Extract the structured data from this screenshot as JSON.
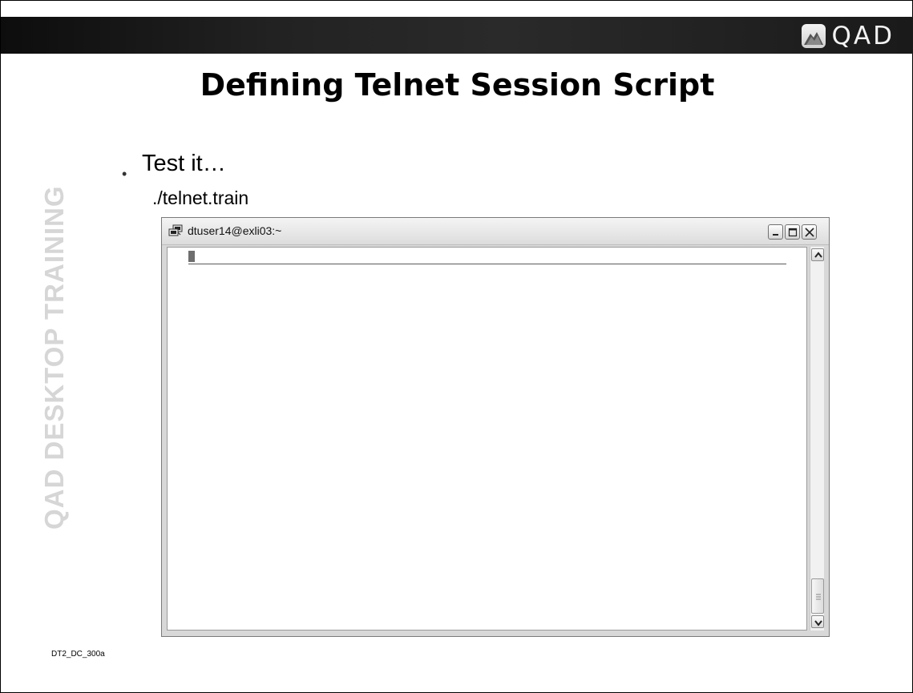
{
  "slide": {
    "title": "Defining Telnet Session Script",
    "logo_text": "QAD",
    "side_watermark": "QAD DESKTOP TRAINING",
    "bullet": "Test it…",
    "command": "./telnet.train",
    "footer_code": "DT2_DC_300a"
  },
  "window": {
    "title": "dtuser14@exli03:~",
    "icon": "putty-terminal-icon",
    "controls": [
      "minimize-icon",
      "maximize-icon",
      "close-icon"
    ],
    "scrollbar_position": 1.0
  },
  "colors": {
    "top_bar": "#1a1a1a",
    "watermark": "#d6d6d6",
    "title_text": "#000000"
  }
}
